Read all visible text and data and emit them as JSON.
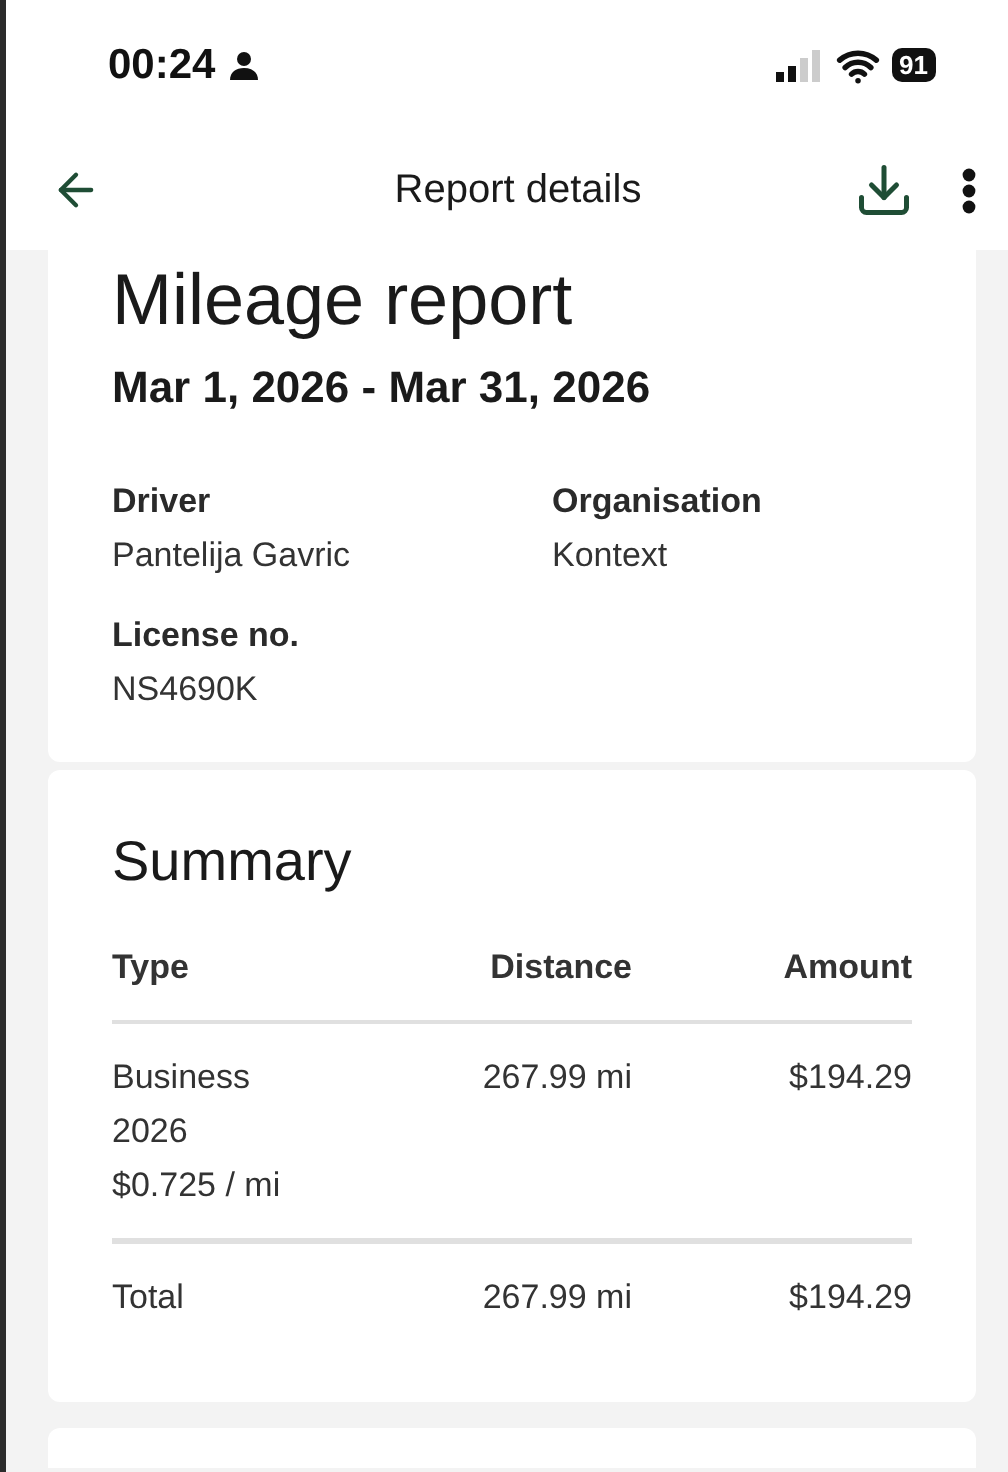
{
  "status_bar": {
    "time": "00:24",
    "battery": "91"
  },
  "header": {
    "title": "Report details"
  },
  "report": {
    "title": "Mileage report",
    "period": "Mar 1, 2026 - Mar 31, 2026",
    "fields": [
      {
        "label": "Driver",
        "value": "Pantelija Gavric"
      },
      {
        "label": "Organisation",
        "value": "Kontext"
      },
      {
        "label": "License no.",
        "value": "NS4690K"
      }
    ]
  },
  "summary": {
    "title": "Summary",
    "columns": [
      "Type",
      "Distance",
      "Amount"
    ],
    "rows": [
      {
        "type_lines": [
          "Business",
          "2026",
          "$0.725 / mi"
        ],
        "distance": "267.99 mi",
        "amount": "$194.29"
      }
    ],
    "total": {
      "label": "Total",
      "distance": "267.99 mi",
      "amount": "$194.29"
    }
  }
}
